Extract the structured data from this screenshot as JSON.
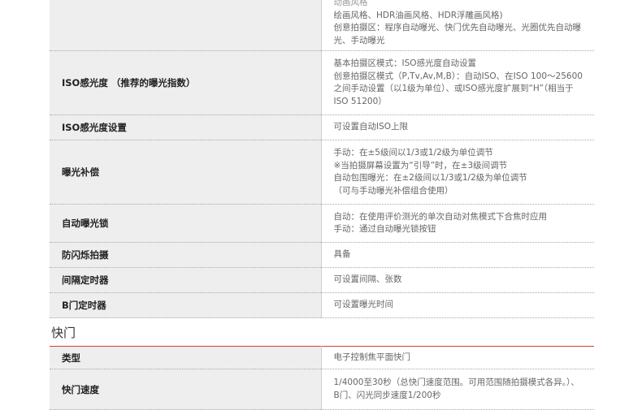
{
  "top_table": {
    "rows": [
      {
        "label": "",
        "lines": [
          "动画风格",
          "绘画风格、HDR油画风格、HDR浮雕画风格)",
          "创意拍摄区：程序自动曝光、快门优先自动曝光、光圈优先自动曝光、手动曝光"
        ]
      },
      {
        "label": "ISO感光度 （推荐的曝光指数）",
        "lines": [
          "基本拍摄区模式：ISO感光度自动设置",
          "创意拍摄区模式（P,Tv,Av,M,B）：自动ISO、在ISO 100～25600之间手动设置（以1级为单位）、或ISO感光度扩展到“H”（相当于ISO 51200）"
        ]
      },
      {
        "label": "ISO感光度设置",
        "lines": [
          "可设置自动ISO上限"
        ]
      },
      {
        "label": "曝光补偿",
        "lines": [
          "手动：在±5级间以1/3或1/2级为单位调节",
          "※当拍摄屏幕设置为“引导”时，在±3级间调节",
          "自动包围曝光：在±2级间以1/3或1/2级为单位调节",
          "（可与手动曝光补偿组合使用）"
        ]
      },
      {
        "label": "自动曝光锁",
        "lines": [
          "自动：在使用评价测光的单次自动对焦模式下合焦时应用",
          "手动：通过自动曝光锁按钮"
        ]
      },
      {
        "label": "防闪烁拍摄",
        "lines": [
          "具备"
        ]
      },
      {
        "label": "间隔定时器",
        "lines": [
          "可设置间隔、张数"
        ]
      },
      {
        "label": "B门定时器",
        "lines": [
          "可设置曝光时间"
        ]
      }
    ]
  },
  "shutter_section": {
    "heading": "快门",
    "rows": [
      {
        "label": "类型",
        "lines": [
          "电子控制焦平面快门"
        ]
      },
      {
        "label": "快门速度",
        "lines": [
          "1/4000至30秒（总快门速度范围。可用范围随拍摄模式各异。）、B门、闪光同步速度1/200秒"
        ]
      }
    ]
  },
  "colors": {
    "label_bg": "#eeeeee",
    "accent_rule": "#d43f3a"
  }
}
